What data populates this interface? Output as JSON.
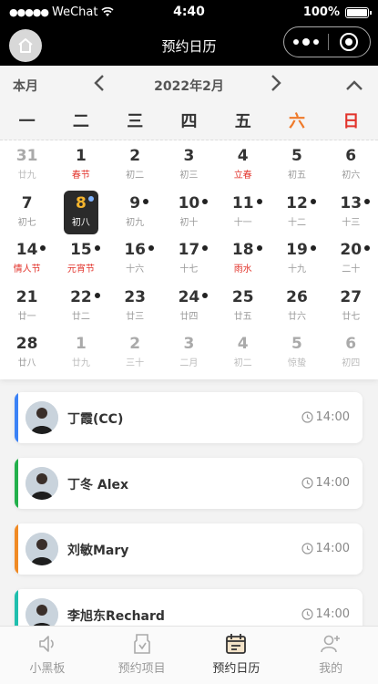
{
  "status": {
    "carrier": "WeChat",
    "time": "4:40",
    "battery": "100%"
  },
  "nav": {
    "title": "预约日历",
    "home_icon": "home-icon",
    "more_icon": "more-dots-icon",
    "close_icon": "record-icon"
  },
  "calendar": {
    "month_button": "本月",
    "year_month": "2022年2月",
    "prev": "‹",
    "next": "›",
    "collapse": "⌃",
    "weekdays": [
      "一",
      "二",
      "三",
      "四",
      "五",
      "六",
      "日"
    ],
    "days": [
      {
        "n": "31",
        "s": "廿九",
        "o": true
      },
      {
        "n": "1",
        "s": "春节",
        "r": true
      },
      {
        "n": "2",
        "s": "初二"
      },
      {
        "n": "3",
        "s": "初三"
      },
      {
        "n": "4",
        "s": "立春",
        "r": true
      },
      {
        "n": "5",
        "s": "初五"
      },
      {
        "n": "6",
        "s": "初六"
      },
      {
        "n": "7",
        "s": "初七"
      },
      {
        "n": "8",
        "s": "初八",
        "t": true,
        "d": true
      },
      {
        "n": "9",
        "s": "初九",
        "d": true
      },
      {
        "n": "10",
        "s": "初十",
        "d": true
      },
      {
        "n": "11",
        "s": "十一",
        "d": true
      },
      {
        "n": "12",
        "s": "十二",
        "d": true
      },
      {
        "n": "13",
        "s": "十三",
        "d": true
      },
      {
        "n": "14",
        "s": "情人节",
        "r": true,
        "d": true
      },
      {
        "n": "15",
        "s": "元宵节",
        "r": true,
        "d": true
      },
      {
        "n": "16",
        "s": "十六",
        "d": true
      },
      {
        "n": "17",
        "s": "十七",
        "d": true
      },
      {
        "n": "18",
        "s": "雨水",
        "r": true,
        "d": true
      },
      {
        "n": "19",
        "s": "十九",
        "d": true
      },
      {
        "n": "20",
        "s": "二十",
        "d": true
      },
      {
        "n": "21",
        "s": "廿一"
      },
      {
        "n": "22",
        "s": "廿二",
        "d": true
      },
      {
        "n": "23",
        "s": "廿三"
      },
      {
        "n": "24",
        "s": "廿四",
        "d": true
      },
      {
        "n": "25",
        "s": "廿五"
      },
      {
        "n": "26",
        "s": "廿六"
      },
      {
        "n": "27",
        "s": "廿七"
      },
      {
        "n": "28",
        "s": "廿八"
      },
      {
        "n": "1",
        "s": "廿九",
        "o": true
      },
      {
        "n": "2",
        "s": "三十",
        "o": true
      },
      {
        "n": "3",
        "s": "二月",
        "o": true
      },
      {
        "n": "4",
        "s": "初二",
        "o": true
      },
      {
        "n": "5",
        "s": "惊蛰",
        "o": true,
        "r": true
      },
      {
        "n": "6",
        "s": "初四",
        "o": true
      }
    ]
  },
  "appointments": [
    {
      "name": "丁霞(CC)",
      "time": "14:00",
      "color": "#3b82f6"
    },
    {
      "name": "丁冬 Alex",
      "time": "14:00",
      "color": "#22b04b"
    },
    {
      "name": "刘敏Mary",
      "time": "14:00",
      "color": "#f08a24"
    },
    {
      "name": "李旭东Rechard",
      "time": "14:00",
      "color": "#1fbfae"
    }
  ],
  "tabs": [
    {
      "label": "小黑板",
      "icon": "speaker-icon"
    },
    {
      "label": "预约项目",
      "icon": "document-icon"
    },
    {
      "label": "预约日历",
      "icon": "calendar-icon",
      "active": true
    },
    {
      "label": "我的",
      "icon": "user-add-icon"
    }
  ]
}
